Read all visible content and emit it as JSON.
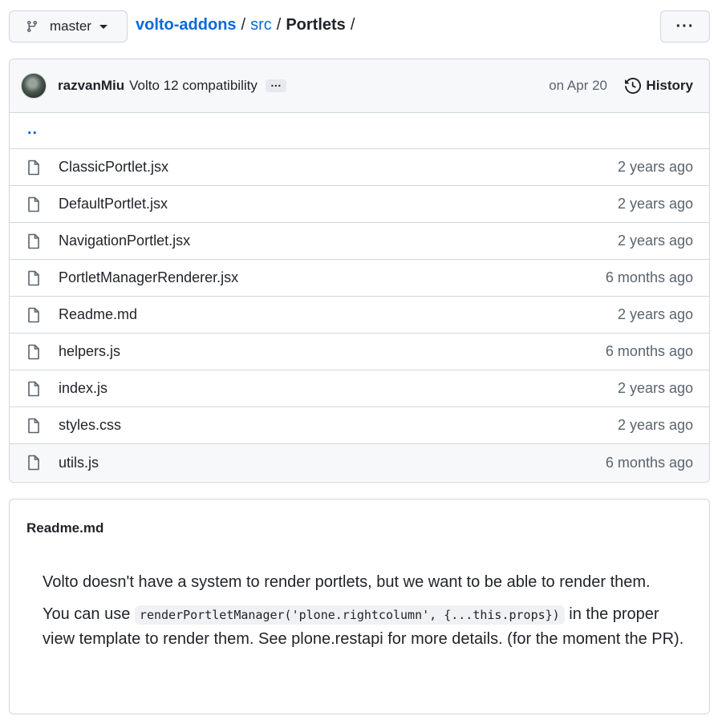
{
  "branch": {
    "name": "master",
    "icon": "git-branch-icon"
  },
  "breadcrumb": {
    "repo": "volto-addons",
    "sep1": "/",
    "dir": "src",
    "sep2": "/",
    "current": "Portlets",
    "sep3": "/"
  },
  "more_button": {
    "label": "···"
  },
  "commit": {
    "author": "razvanMiu",
    "message": "Volto 12 compatibility",
    "ellipsis": "…",
    "date": "on Apr 20",
    "history_label": "History"
  },
  "parent_dir": {
    "label": ".."
  },
  "files": [
    {
      "name": "ClassicPortlet.jsx",
      "age": "2 years ago"
    },
    {
      "name": "DefaultPortlet.jsx",
      "age": "2 years ago"
    },
    {
      "name": "NavigationPortlet.jsx",
      "age": "2 years ago"
    },
    {
      "name": "PortletManagerRenderer.jsx",
      "age": "6 months ago"
    },
    {
      "name": "Readme.md",
      "age": "2 years ago"
    },
    {
      "name": "helpers.js",
      "age": "6 months ago"
    },
    {
      "name": "index.js",
      "age": "2 years ago"
    },
    {
      "name": "styles.css",
      "age": "2 years ago"
    },
    {
      "name": "utils.js",
      "age": "6 months ago"
    }
  ],
  "readme": {
    "title": "Readme.md",
    "p1": "Volto doesn't have a system to render portlets, but we want to be able to render them.",
    "p2_before": "You can use ",
    "p2_code": "renderPortletManager('plone.rightcolumn', {...this.props})",
    "p2_after": " in the proper view template to render them. See plone.restapi for more details. (for the moment the PR)."
  },
  "colors": {
    "link": "#0969da",
    "text": "#1f2328",
    "muted": "#59636e",
    "border": "#d0d7de",
    "header_bg": "#f6f8fa"
  }
}
